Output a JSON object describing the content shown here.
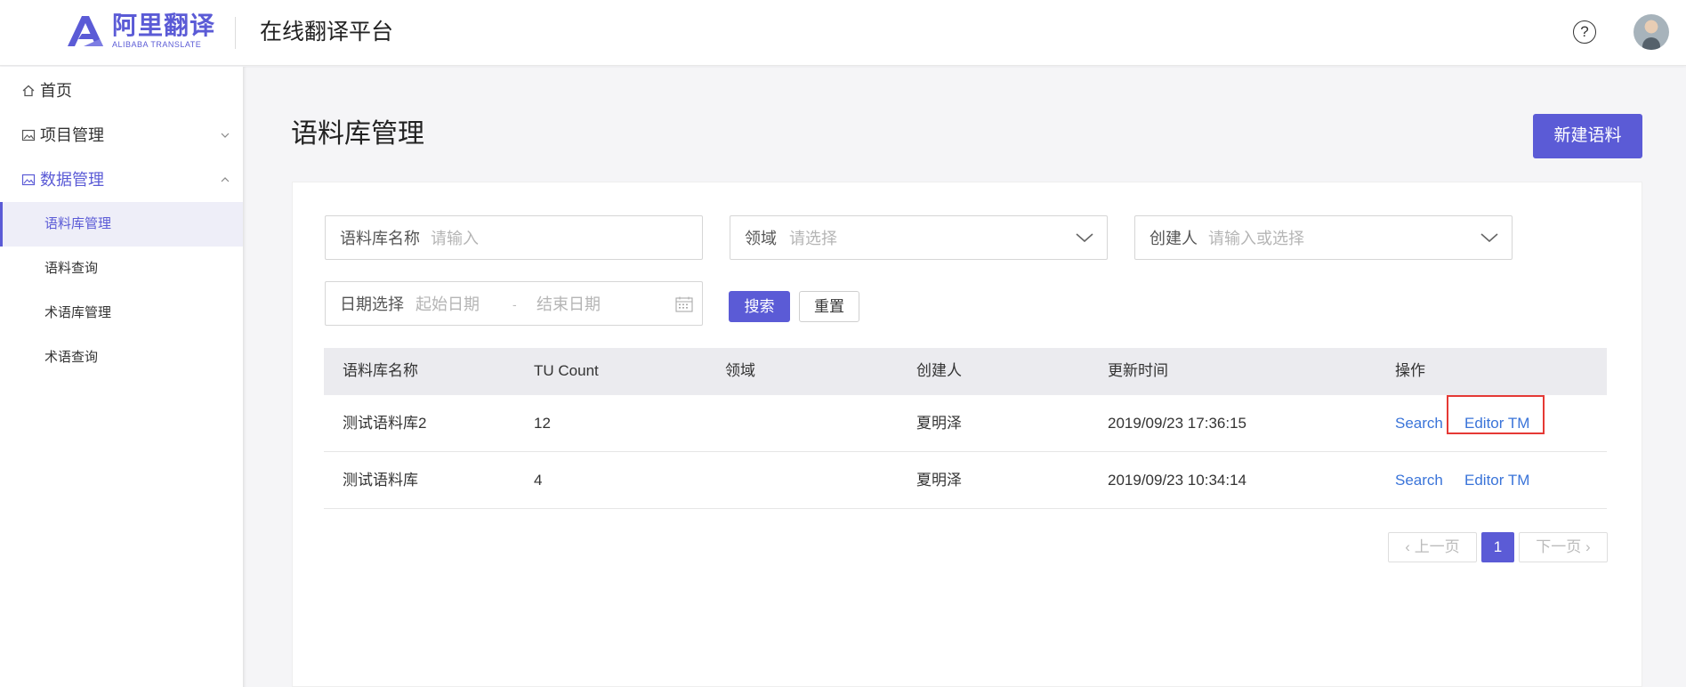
{
  "header": {
    "logo_cn": "阿里翻译",
    "logo_en": "ALIBABA TRANSLATE",
    "platform_title": "在线翻译平台",
    "help_icon": "?"
  },
  "sidebar": {
    "items": [
      {
        "label": "首页",
        "icon": "home-icon"
      },
      {
        "label": "项目管理",
        "icon": "image-icon",
        "expanded": false
      },
      {
        "label": "数据管理",
        "icon": "image-icon",
        "expanded": true
      }
    ],
    "sub_items": [
      {
        "label": "语料库管理",
        "active": true
      },
      {
        "label": "语料查询"
      },
      {
        "label": "术语库管理"
      },
      {
        "label": "术语查询"
      }
    ]
  },
  "main": {
    "page_title": "语料库管理",
    "new_button": "新建语料",
    "filters": {
      "name_label": "语料库名称",
      "name_placeholder": "请输入",
      "domain_label": "领域",
      "domain_placeholder": "请选择",
      "creator_label": "创建人",
      "creator_placeholder": "请输入或选择",
      "date_label": "日期选择",
      "start_placeholder": "起始日期",
      "date_separator": "-",
      "end_placeholder": "结束日期",
      "search_button": "搜索",
      "reset_button": "重置"
    },
    "table": {
      "columns": [
        "语料库名称",
        "TU Count",
        "领域",
        "创建人",
        "更新时间",
        "操作"
      ],
      "rows": [
        {
          "name": "测试语料库2",
          "tu_count": "12",
          "domain": "",
          "creator": "夏明泽",
          "updated": "2019/09/23 17:36:15",
          "action_search": "Search",
          "action_edit": "Editor TM"
        },
        {
          "name": "测试语料库",
          "tu_count": "4",
          "domain": "",
          "creator": "夏明泽",
          "updated": "2019/09/23 10:34:14",
          "action_search": "Search",
          "action_edit": "Editor TM"
        }
      ]
    },
    "pagination": {
      "prev": "上一页",
      "current": "1",
      "next": "下一页"
    }
  },
  "colors": {
    "accent": "#5b5bd6",
    "link": "#3a74d9",
    "highlight": "#e53935"
  }
}
